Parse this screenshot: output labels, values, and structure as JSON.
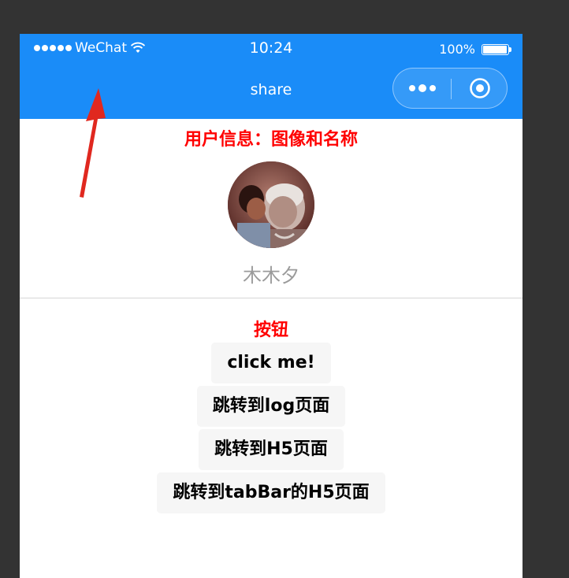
{
  "status_bar": {
    "carrier": "WeChat",
    "time": "10:24",
    "battery": "100%",
    "signal_bars": 5,
    "icons": [
      "wifi-icon",
      "battery-icon"
    ]
  },
  "nav_bar": {
    "title": "share",
    "color": "#1a8cf8",
    "icons": [
      "more-icon",
      "close-icon"
    ]
  },
  "user_section": {
    "title": "用户信息：图像和名称",
    "nickname": "木木夕"
  },
  "button_section": {
    "title": "按钮",
    "buttons": [
      "click me!",
      "跳转到log页面",
      "跳转到H5页面",
      "跳转到tabBar的H5页面"
    ]
  },
  "colors": {
    "accent": "#1a8cf8",
    "section_title": "#ff0000",
    "arrow": "#e0281f"
  }
}
